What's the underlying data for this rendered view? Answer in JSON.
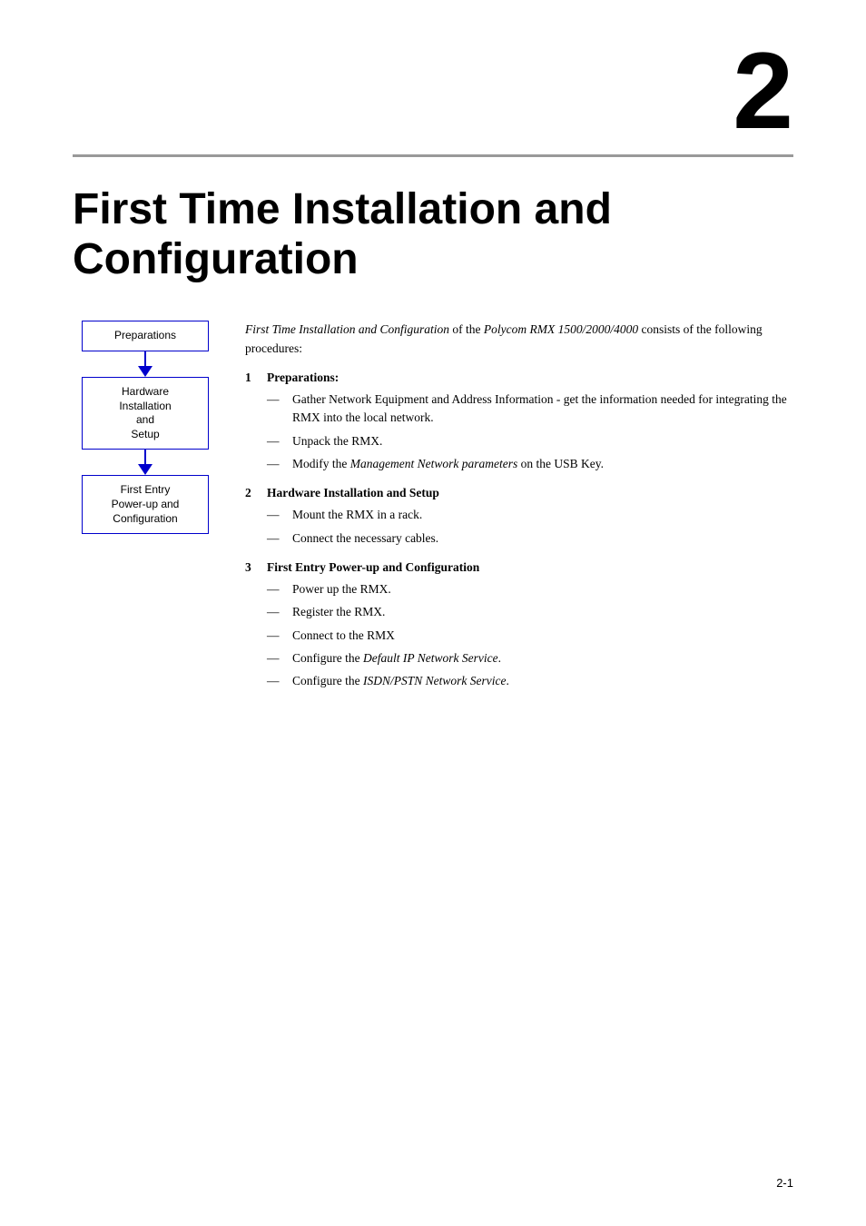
{
  "chapter": {
    "number": "2",
    "title": "First Time Installation and\nConfiguration",
    "horizontal_rule": true
  },
  "flowchart": {
    "boxes": [
      {
        "id": "preparations",
        "label": "Preparations"
      },
      {
        "id": "hardware-installation",
        "label": "Hardware Installation and Setup"
      },
      {
        "id": "first-entry",
        "label": "First Entry Power-up and Configuration"
      }
    ]
  },
  "intro": {
    "part1": "First Time Installation and Configuration",
    "part2": "of the",
    "part3": "Polycom RMX 1500/2000/4000",
    "part4": "consists of the following procedures:"
  },
  "procedures": [
    {
      "number": "1",
      "label": "Preparations:",
      "subitems": [
        {
          "text": "Gather Network Equipment and Address Information - get the information needed for integrating the RMX into the local network."
        },
        {
          "text": "Unpack the RMX."
        },
        {
          "text": "Modify the ",
          "italic": "Management Network parameters",
          "suffix": " on the USB Key."
        }
      ]
    },
    {
      "number": "2",
      "label": "Hardware Installation and Setup",
      "subitems": [
        {
          "text": "Mount the RMX in a rack."
        },
        {
          "text": "Connect the necessary cables."
        }
      ]
    },
    {
      "number": "3",
      "label": "First Entry Power-up and Configuration",
      "subitems": [
        {
          "text": "Power up the RMX."
        },
        {
          "text": "Register the RMX."
        },
        {
          "text": "Connect to the RMX"
        },
        {
          "text": "Configure the ",
          "italic": "Default IP Network Service",
          "suffix": "."
        },
        {
          "text": "Configure the ",
          "italic": "ISDN/PSTN Network Service",
          "suffix": "."
        }
      ]
    }
  ],
  "page_number": "2-1"
}
